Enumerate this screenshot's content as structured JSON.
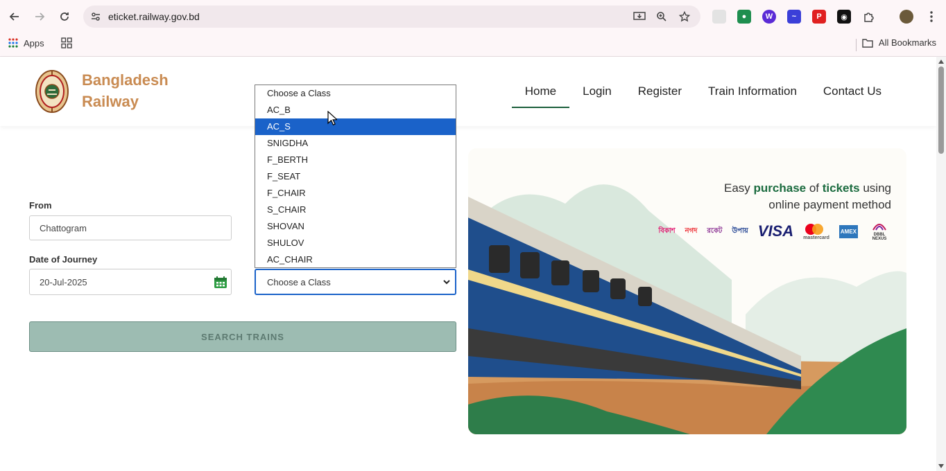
{
  "browser": {
    "url": "eticket.railway.gov.bd",
    "bookmarks": {
      "apps_label": "Apps",
      "all_bookmarks_label": "All Bookmarks"
    }
  },
  "header": {
    "brand_line1": "Bangladesh",
    "brand_line2": "Railway",
    "nav": [
      {
        "label": "Home",
        "active": true
      },
      {
        "label": "Login"
      },
      {
        "label": "Register"
      },
      {
        "label": "Train Information"
      },
      {
        "label": "Contact Us"
      }
    ]
  },
  "form": {
    "from_label": "From",
    "from_value": "Chattogram",
    "date_label": "Date of Journey",
    "date_value": "20-Jul-2025",
    "class_selected": "Choose a Class",
    "class_options": [
      "Choose a Class",
      "AC_B",
      "AC_S",
      "SNIGDHA",
      "F_BERTH",
      "F_SEAT",
      "F_CHAIR",
      "S_CHAIR",
      "SHOVAN",
      "SHULOV",
      "AC_CHAIR"
    ],
    "class_highlighted": "AC_S",
    "search_button": "SEARCH TRAINS"
  },
  "hero": {
    "tagline_parts": [
      "Easy ",
      "purchase",
      " of ",
      "tickets",
      " using",
      "online payment method"
    ],
    "payment_methods": [
      "বিকাশ",
      "নগদ",
      "রকেট",
      "উপায়",
      "VISA",
      "mastercard",
      "AMEX",
      "DBBL NEXUS"
    ]
  },
  "colors": {
    "brand": "#c98b52",
    "accent_green": "#1b6b3f",
    "select_blue": "#1a62c9",
    "button_bg": "#9dbcb2"
  }
}
